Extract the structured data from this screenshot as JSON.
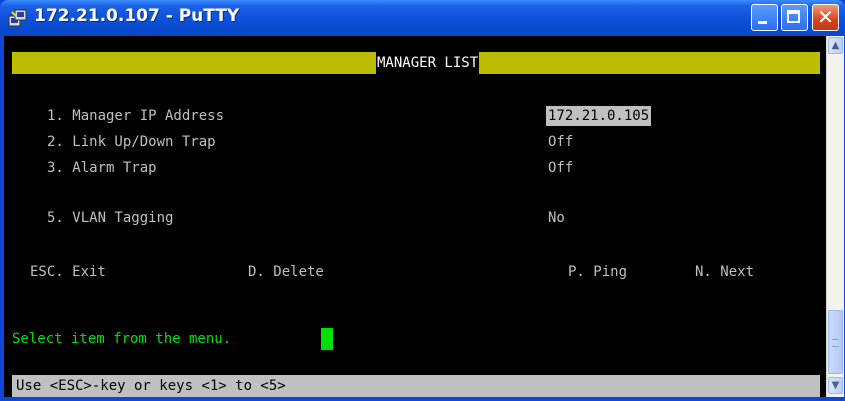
{
  "window": {
    "title": "172.21.0.107 - PuTTY",
    "title_color": "#ffffff",
    "titlebar_color": "#0b4fd6"
  },
  "icons": {
    "app": "putty-icon",
    "minimize": "minimize-icon",
    "maximize": "maximize-icon",
    "close": "close-icon",
    "scroll_up": "chevron-up-icon",
    "scroll_down": "chevron-down-icon"
  },
  "terminal": {
    "header": "MANAGER LIST",
    "header_bar_color": "#bdbd00",
    "text_color": "#c0c0c0",
    "prompt_color": "#00e000",
    "menu": [
      {
        "label": "1. Manager IP Address",
        "value": "172.21.0.105",
        "selected": true
      },
      {
        "label": "2. Link Up/Down Trap",
        "value": "Off"
      },
      {
        "label": "3. Alarm Trap",
        "value": "Off"
      },
      {
        "label": "5. VLAN Tagging",
        "value": "No"
      }
    ],
    "commands": {
      "exit": "ESC. Exit",
      "delete": "D. Delete",
      "ping": "P. Ping",
      "next": "N. Next"
    },
    "prompt": "Select item from the menu.",
    "status": "Use <ESC>-key or keys <1> to <5>"
  }
}
